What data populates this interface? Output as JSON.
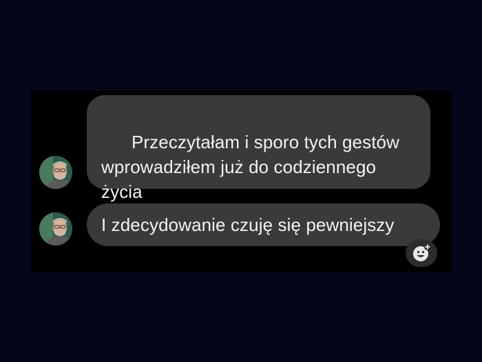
{
  "conversation": {
    "messages": [
      {
        "text": "Przeczytałam i sporo tych gestów\nwprowadziłem już do codziennego\nżycia"
      },
      {
        "text": "I zdecydowanie czuję się pewniejszy"
      }
    ],
    "reaction_button_icon": "add-reaction-smiley-icon"
  },
  "colors": {
    "page_background": "#05061a",
    "panel_background": "#000000",
    "bubble_background": "#3a3a3c",
    "bubble_text": "#f2f2f2",
    "reaction_button_background": "#2c2c2e"
  }
}
